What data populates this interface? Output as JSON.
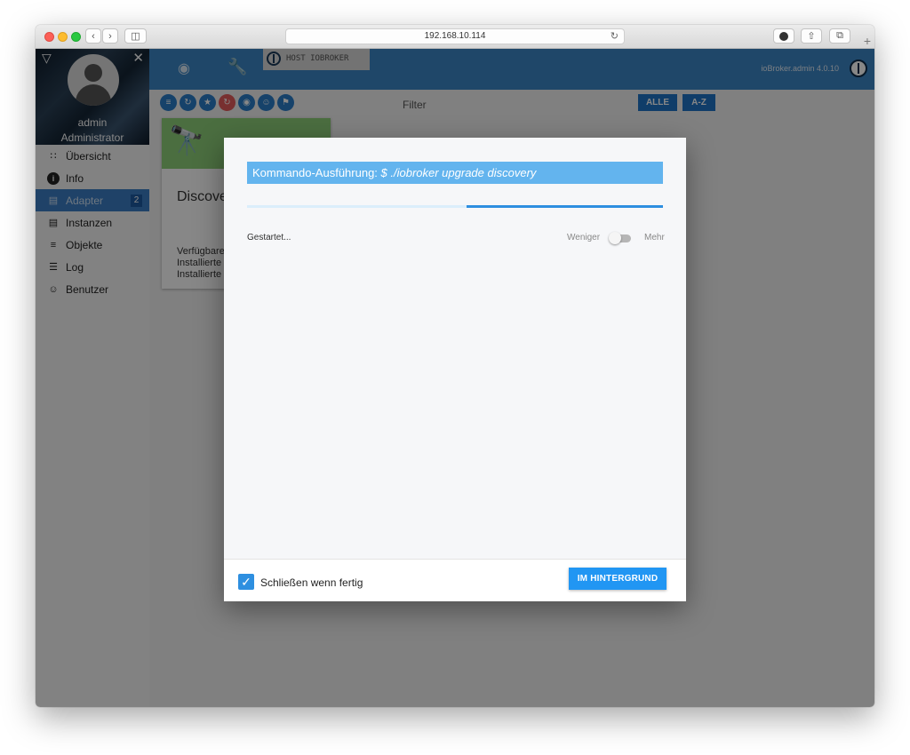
{
  "browser": {
    "url": "192.168.10.114"
  },
  "sidebar": {
    "username": "admin",
    "role": "Administrator",
    "items": [
      {
        "label": "Übersicht",
        "icon": "grid-icon"
      },
      {
        "label": "Info",
        "icon": "info-icon"
      },
      {
        "label": "Adapter",
        "icon": "store-icon",
        "badge": "2",
        "active": true
      },
      {
        "label": "Instanzen",
        "icon": "instances-icon"
      },
      {
        "label": "Objekte",
        "icon": "list-icon"
      },
      {
        "label": "Log",
        "icon": "log-icon"
      },
      {
        "label": "Benutzer",
        "icon": "user-icon"
      }
    ]
  },
  "topbar": {
    "host_tab": "HOST IOBROKER",
    "version": "ioBroker.admin 4.0.10"
  },
  "toolbar": {
    "filter_label": "Filter",
    "sort_all": "ALLE",
    "sort_az": "A-Z"
  },
  "card": {
    "title": "Discove",
    "line1": "Verfügbare",
    "line2": "Installierte",
    "line3": "Installierte"
  },
  "dialog": {
    "title_prefix": "Kommando-Ausführung: ",
    "command": "$ ./iobroker upgrade discovery",
    "status": "Gestartet...",
    "toggle_less": "Weniger",
    "toggle_more": "Mehr",
    "close_when_done": "Schließen wenn fertig",
    "close_checked": true,
    "background_button": "IM HINTERGRUND"
  },
  "colors": {
    "accent": "#2196f3",
    "header_blue": "#3b86c6",
    "command_bar": "#63b4ee"
  }
}
